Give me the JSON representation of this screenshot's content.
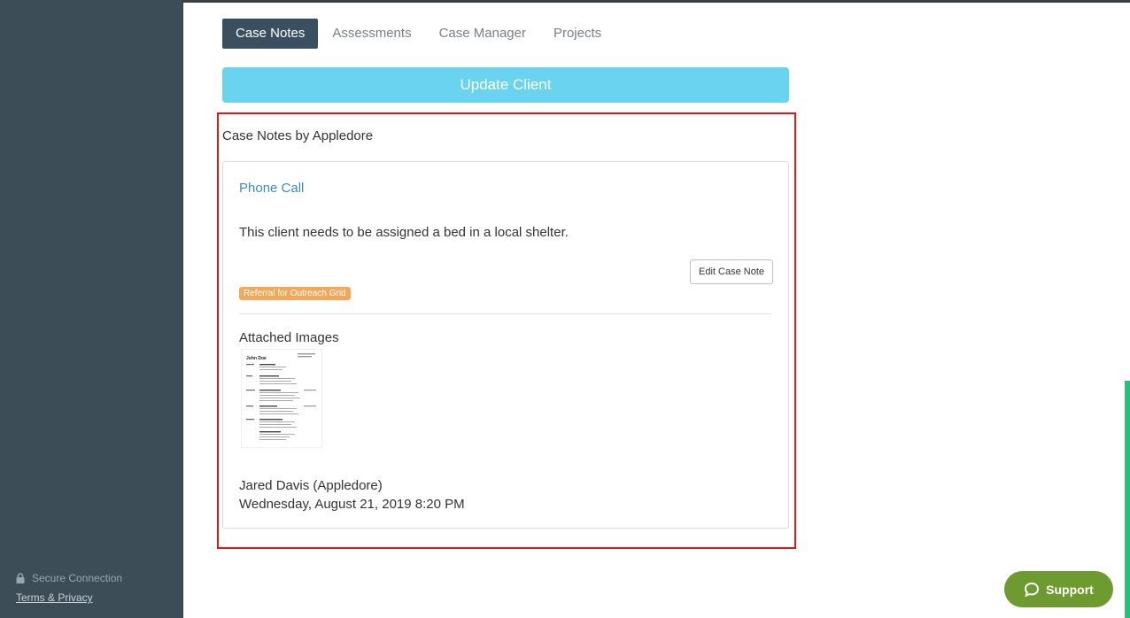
{
  "sidebar": {
    "secure_text": "Secure Connection",
    "terms_link": "Terms & Privacy"
  },
  "tabs": [
    {
      "label": "Case Notes",
      "active": true
    },
    {
      "label": "Assessments",
      "active": false
    },
    {
      "label": "Case Manager",
      "active": false
    },
    {
      "label": "Projects",
      "active": false
    }
  ],
  "update_button": "Update Client",
  "case_notes": {
    "section_title": "Case Notes by Appledore",
    "note": {
      "type": "Phone Call",
      "body": "This client needs to be assigned a bed in a local shelter.",
      "edit_label": "Edit Case Note",
      "tag": "Referral for Outreach Grid",
      "attached_title": "Attached Images",
      "attachment_preview": {
        "name": "John Doe"
      },
      "author": "Jared Davis (Appledore)",
      "date": "Wednesday, August 21, 2019 8:20 PM"
    }
  },
  "support_button": "Support",
  "colors": {
    "sidebar": "#3d4d57",
    "active_tab": "#3a5060",
    "update_button": "#6ad4f0",
    "note_type_link": "#3a8fb7",
    "tag": "#f0a85a",
    "highlight_border": "#e01818",
    "support": "#6e9b30",
    "scroll_indicator": "#2dbd7a"
  }
}
